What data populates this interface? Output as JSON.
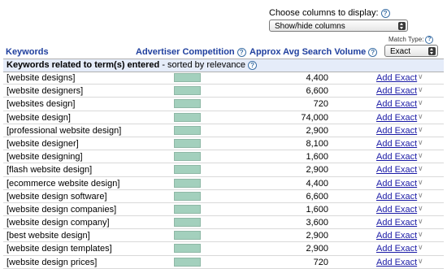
{
  "controls": {
    "choose_label": "Choose columns to display:",
    "columns_select": "Show/hide columns",
    "match_type_label": "Match Type:",
    "match_type_select": "Exact"
  },
  "headers": {
    "keywords": "Keywords",
    "competition": "Advertiser Competition",
    "volume": "Approx Avg Search Volume"
  },
  "section": {
    "title": "Keywords related to term(s) entered",
    "subtitle": " - sorted by relevance"
  },
  "icons": {
    "help": "question-mark-help-icon",
    "row_menu": "chevron-down-icon"
  },
  "colors": {
    "header_text": "#1f3f9e",
    "section_bg": "#e5ecf9",
    "competition_bar": "#a3d0bd",
    "link": "#1a1aa6"
  },
  "add_label": "Add Exact",
  "rows": [
    {
      "keyword": "[website designs]",
      "volume": "4,400"
    },
    {
      "keyword": "[website designers]",
      "volume": "6,600"
    },
    {
      "keyword": "[websites design]",
      "volume": "720"
    },
    {
      "keyword": "[website design]",
      "volume": "74,000"
    },
    {
      "keyword": "[professional website design]",
      "volume": "2,900"
    },
    {
      "keyword": "[website designer]",
      "volume": "8,100"
    },
    {
      "keyword": "[website designing]",
      "volume": "1,600"
    },
    {
      "keyword": "[flash website design]",
      "volume": "2,900"
    },
    {
      "keyword": "[ecommerce website design]",
      "volume": "4,400"
    },
    {
      "keyword": "[website design software]",
      "volume": "6,600"
    },
    {
      "keyword": "[website design companies]",
      "volume": "1,600"
    },
    {
      "keyword": "[website design company]",
      "volume": "3,600"
    },
    {
      "keyword": "[best website design]",
      "volume": "2,900"
    },
    {
      "keyword": "[website design templates]",
      "volume": "2,900"
    },
    {
      "keyword": "[website design prices]",
      "volume": "720"
    }
  ]
}
